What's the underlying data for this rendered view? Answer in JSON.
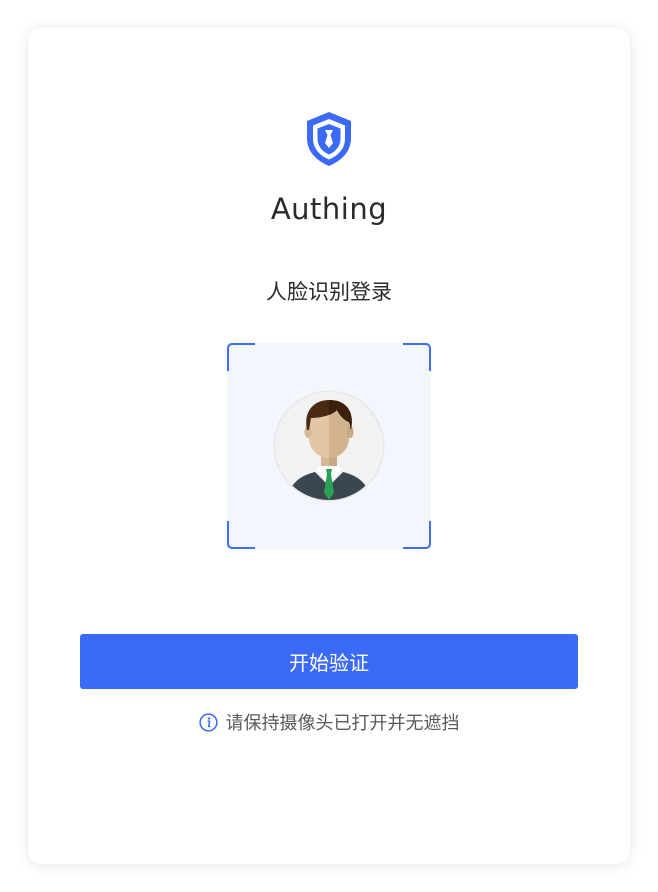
{
  "brand": {
    "name": "Authing",
    "logo_icon": "shield-logo-icon",
    "accent_color": "#3b6af7"
  },
  "login": {
    "title": "人脸识别登录",
    "avatar_icon": "face-avatar-icon",
    "start_button_label": "开始验证",
    "hint_icon": "info-icon",
    "hint_text": "请保持摄像头已打开并无遮挡"
  }
}
